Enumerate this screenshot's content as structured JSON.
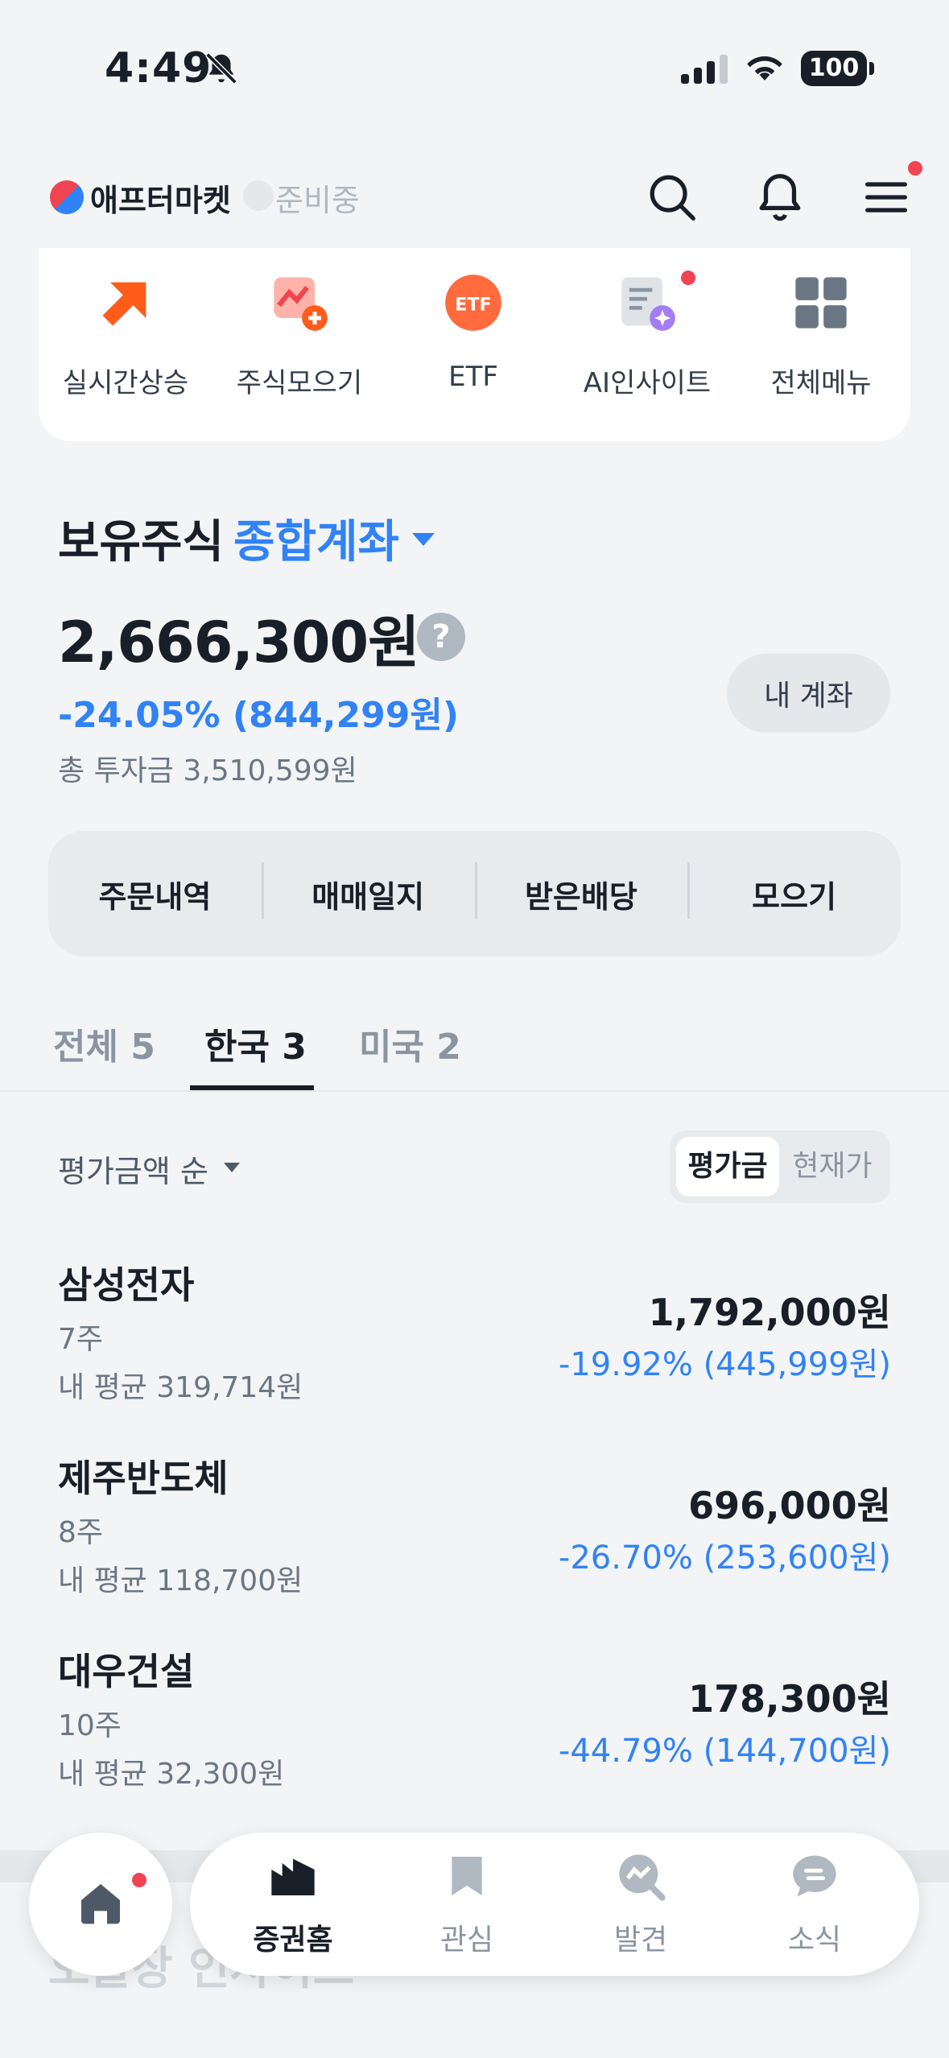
{
  "status_bar": {
    "time": "4:49",
    "battery": "100"
  },
  "header": {
    "market_name": "애프터마켓",
    "market_status": "준비중",
    "icons": [
      "search-icon",
      "bell-icon",
      "menu-icon"
    ]
  },
  "quick_menu": [
    {
      "label": "실시간상승",
      "icon": "arrow-up-right-icon"
    },
    {
      "label": "주식모으기",
      "icon": "chart-plus-icon"
    },
    {
      "label": "ETF",
      "icon": "etf-icon"
    },
    {
      "label": "AI인사이트",
      "icon": "ai-document-icon"
    },
    {
      "label": "전체메뉴",
      "icon": "grid-icon"
    }
  ],
  "holdings": {
    "title": "보유주식",
    "account_type": "종합계좌",
    "total_value": "2,666,300원",
    "profit": "-24.05% (844,299원)",
    "invested": "총 투자금 3,510,599원",
    "my_account_label": "내 계좌"
  },
  "actions": [
    "주문내역",
    "매매일지",
    "받은배당",
    "모으기"
  ],
  "tabs": [
    {
      "label": "전체 5",
      "active": false
    },
    {
      "label": "한국 3",
      "active": true
    },
    {
      "label": "미국 2",
      "active": false
    }
  ],
  "sort": {
    "label": "평가금액 순",
    "toggle_on": "평가금",
    "toggle_off": "현재가"
  },
  "stocks": [
    {
      "name": "삼성전자",
      "qty": "7주",
      "avg": "내 평균 319,714원",
      "value": "1,792,000원",
      "change": "-19.92% (445,999원)"
    },
    {
      "name": "제주반도체",
      "qty": "8주",
      "avg": "내 평균 118,700원",
      "value": "696,000원",
      "change": "-26.70% (253,600원)"
    },
    {
      "name": "대우건설",
      "qty": "10주",
      "avg": "내 평균 32,300원",
      "value": "178,300원",
      "change": "-44.79% (144,700원)"
    }
  ],
  "ghost_text": "오늘장 인사이트",
  "bottom_nav": [
    {
      "label": "증권홈",
      "icon": "chart-building-icon",
      "active": true
    },
    {
      "label": "관심",
      "icon": "bookmark-icon",
      "active": false
    },
    {
      "label": "발견",
      "icon": "discover-icon",
      "active": false
    },
    {
      "label": "소식",
      "icon": "chat-bubble-icon",
      "active": false
    }
  ],
  "colors": {
    "accent": "#3182f6",
    "alert": "#f04452",
    "orange": "#ff5c1a"
  }
}
